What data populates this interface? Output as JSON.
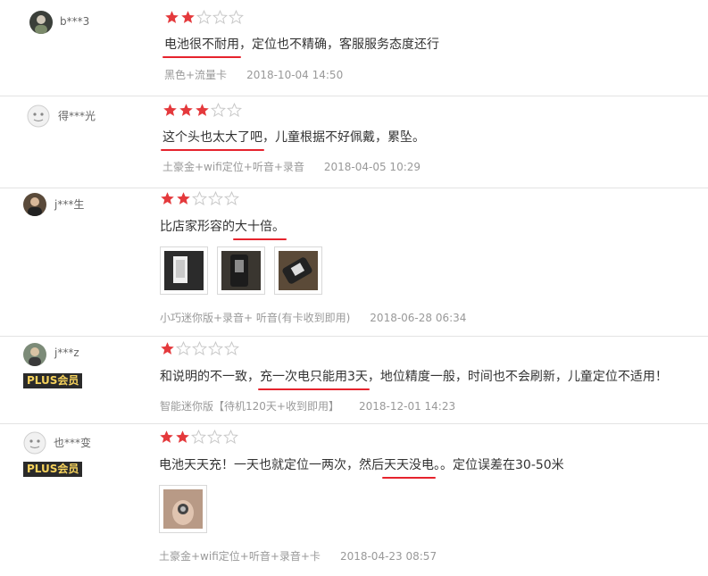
{
  "colors": {
    "star_on": "#e4393c",
    "star_off": "#c8c8c8",
    "highlight": "#e6232d",
    "plus_bg": "#2a2a2a",
    "plus_fg": "#f6d25c"
  },
  "reviews": [
    {
      "username": "b***3",
      "rating": 2,
      "content_segments": [
        {
          "text": "电池很不耐用",
          "highlighted": true
        },
        {
          "text": "，定位也不精确，客服服务态度还行",
          "highlighted": false
        }
      ],
      "product_variant": "黑色+流量卡",
      "date": "2018-10-04 14:50",
      "photos": []
    },
    {
      "username": "得***光",
      "rating": 3,
      "content_segments": [
        {
          "text": "这个头也太大了吧",
          "highlighted": true
        },
        {
          "text": "，儿童根据不好佩戴，累坠。",
          "highlighted": false
        }
      ],
      "product_variant": "土豪金+wifi定位+听音+录音",
      "date": "2018-04-05 10:29",
      "photos": []
    },
    {
      "username": "j***生",
      "rating": 2,
      "content_segments": [
        {
          "text": "比店家形容的",
          "highlighted": false
        },
        {
          "text": "大十倍。",
          "highlighted": true
        }
      ],
      "product_variant": "小巧迷你版+录音+ 听音(有卡收到即用)",
      "date": "2018-06-28 06:34",
      "photos": [
        "photo-1",
        "photo-2",
        "photo-3"
      ]
    },
    {
      "username": "j***z",
      "badge": "PLUS会员",
      "rating": 1,
      "content_segments": [
        {
          "text": "和说明的不一致，",
          "highlighted": false
        },
        {
          "text": "充一次电只能用3天",
          "highlighted": true
        },
        {
          "text": "，地位精度一般，时间也不会刷新，儿童定位不适用！",
          "highlighted": false
        }
      ],
      "product_variant": "智能迷你版【待机120天+收到即用】",
      "date": "2018-12-01 14:23",
      "photos": []
    },
    {
      "username": "也***变",
      "badge": "PLUS会员",
      "rating": 2,
      "content_segments": [
        {
          "text": "电池天天充！一天也就定位一两次，然后",
          "highlighted": false
        },
        {
          "text": "天天没电",
          "highlighted": true
        },
        {
          "text": "。。定位误差在30-50米",
          "highlighted": false
        }
      ],
      "product_variant": "土豪金+wifi定位+听音+录音+卡",
      "date": "2018-04-23 08:57",
      "photos": [
        "photo-1"
      ]
    }
  ]
}
